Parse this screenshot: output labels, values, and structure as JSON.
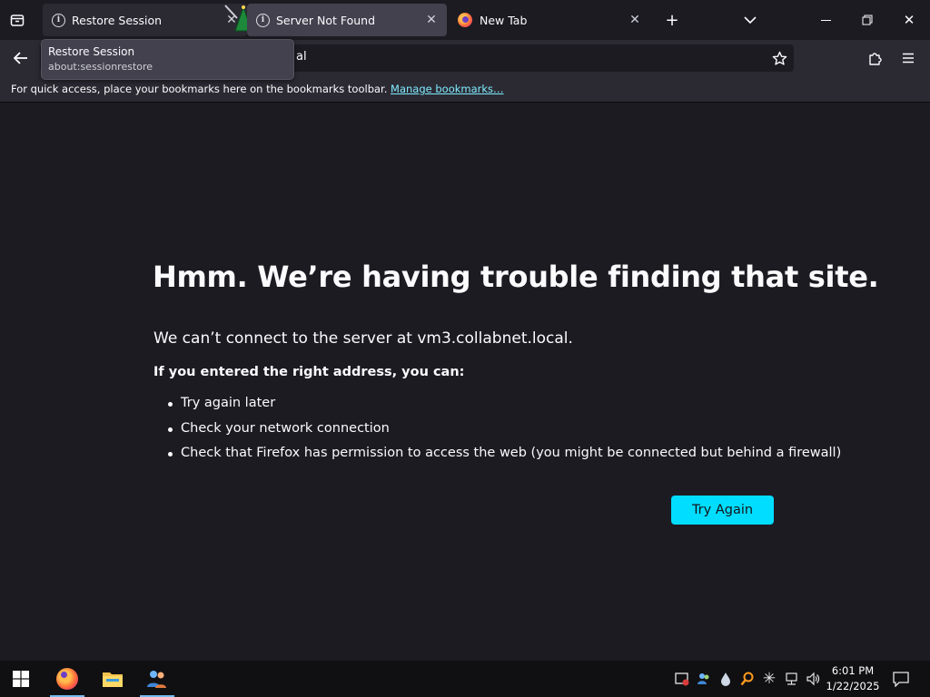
{
  "tabs": [
    {
      "label": "Restore Session",
      "icon": "info-icon",
      "active": false
    },
    {
      "label": "Server Not Found",
      "icon": "info-icon",
      "active": true
    },
    {
      "label": "New Tab",
      "icon": "firefox-icon",
      "active": false
    }
  ],
  "tooltip": {
    "title": "Restore Session",
    "subtitle": "about:sessionrestore"
  },
  "urlbar": {
    "visible_text": "al"
  },
  "bookmarks_toolbar": {
    "message": "For quick access, place your bookmarks here on the bookmarks toolbar.",
    "link": "Manage bookmarks…"
  },
  "error_page": {
    "title": "Hmm. We’re having trouble finding that site.",
    "description": "We can’t connect to the server at vm3.collabnet.local.",
    "subheading": "If you entered the right address, you can:",
    "suggestions": [
      "Try again later",
      "Check your network connection",
      "Check that Firefox has permission to access the web (you might be connected but behind a firewall)"
    ],
    "button_label": "Try Again"
  },
  "taskbar": {
    "apps": [
      "firefox-icon",
      "file-explorer-icon",
      "people-icon"
    ],
    "clock": {
      "time": "6:01 PM",
      "date": "1/22/2025"
    }
  },
  "colors": {
    "page_bg": "#1c1b22",
    "toolbar_bg": "#2b2a33",
    "accent": "#00ddff",
    "link": "#80ebff"
  }
}
